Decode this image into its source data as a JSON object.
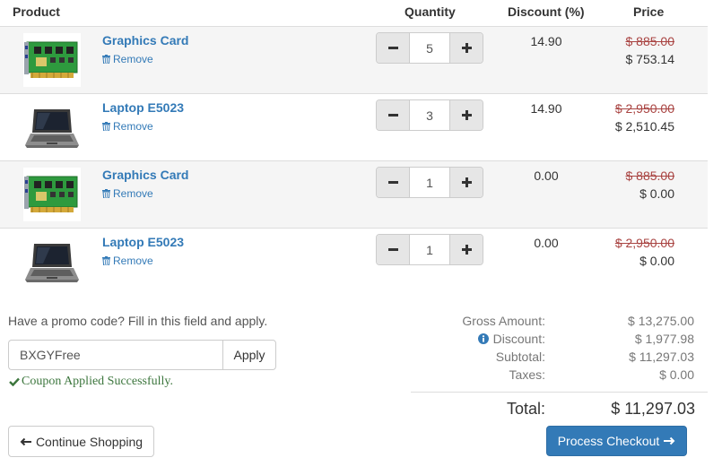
{
  "table": {
    "headers": {
      "product": "Product",
      "quantity": "Quantity",
      "discount": "Discount (%)",
      "price": "Price"
    },
    "rows": [
      {
        "name": "Graphics Card",
        "image": "graphics-card-image",
        "remove": "Remove",
        "qty": "5",
        "discount": "14.90",
        "old_price": "$ 885.00",
        "new_price": "$ 753.14"
      },
      {
        "name": "Laptop E5023",
        "image": "laptop-image",
        "remove": "Remove",
        "qty": "3",
        "discount": "14.90",
        "old_price": "$ 2,950.00",
        "new_price": "$ 2,510.45"
      },
      {
        "name": "Graphics Card",
        "image": "graphics-card-image",
        "remove": "Remove",
        "qty": "1",
        "discount": "0.00",
        "old_price": "$ 885.00",
        "new_price": "$ 0.00"
      },
      {
        "name": "Laptop E5023",
        "image": "laptop-image",
        "remove": "Remove",
        "qty": "1",
        "discount": "0.00",
        "old_price": "$ 2,950.00",
        "new_price": "$ 0.00"
      }
    ]
  },
  "promo": {
    "label": "Have a promo code? Fill in this field and apply.",
    "value": "BXGYFree",
    "apply": "Apply",
    "success": "Coupon Applied Successfully."
  },
  "totals": {
    "gross_label": "Gross Amount:",
    "gross_value": "$ 13,275.00",
    "discount_label": "Discount:",
    "discount_value": "$ 1,977.98",
    "subtotal_label": "Subtotal:",
    "subtotal_value": "$ 11,297.03",
    "taxes_label": "Taxes:",
    "taxes_value": "$ 0.00",
    "total_label": "Total:",
    "total_value": "$ 11,297.03"
  },
  "buttons": {
    "continue": "Continue Shopping",
    "checkout": "Process Checkout"
  },
  "colors": {
    "link": "#337ab7",
    "strike_price": "#a94442",
    "success": "#3c763d",
    "primary": "#337ab7",
    "stripe": "#f5f5f5"
  },
  "icons": {
    "remove": "trash-icon",
    "qty_decrease": "minus-icon",
    "qty_increase": "plus-icon",
    "discount_info": "info-circle-icon",
    "coupon_ok": "check-icon",
    "continue": "arrow-left-icon",
    "checkout": "arrow-right-icon"
  }
}
